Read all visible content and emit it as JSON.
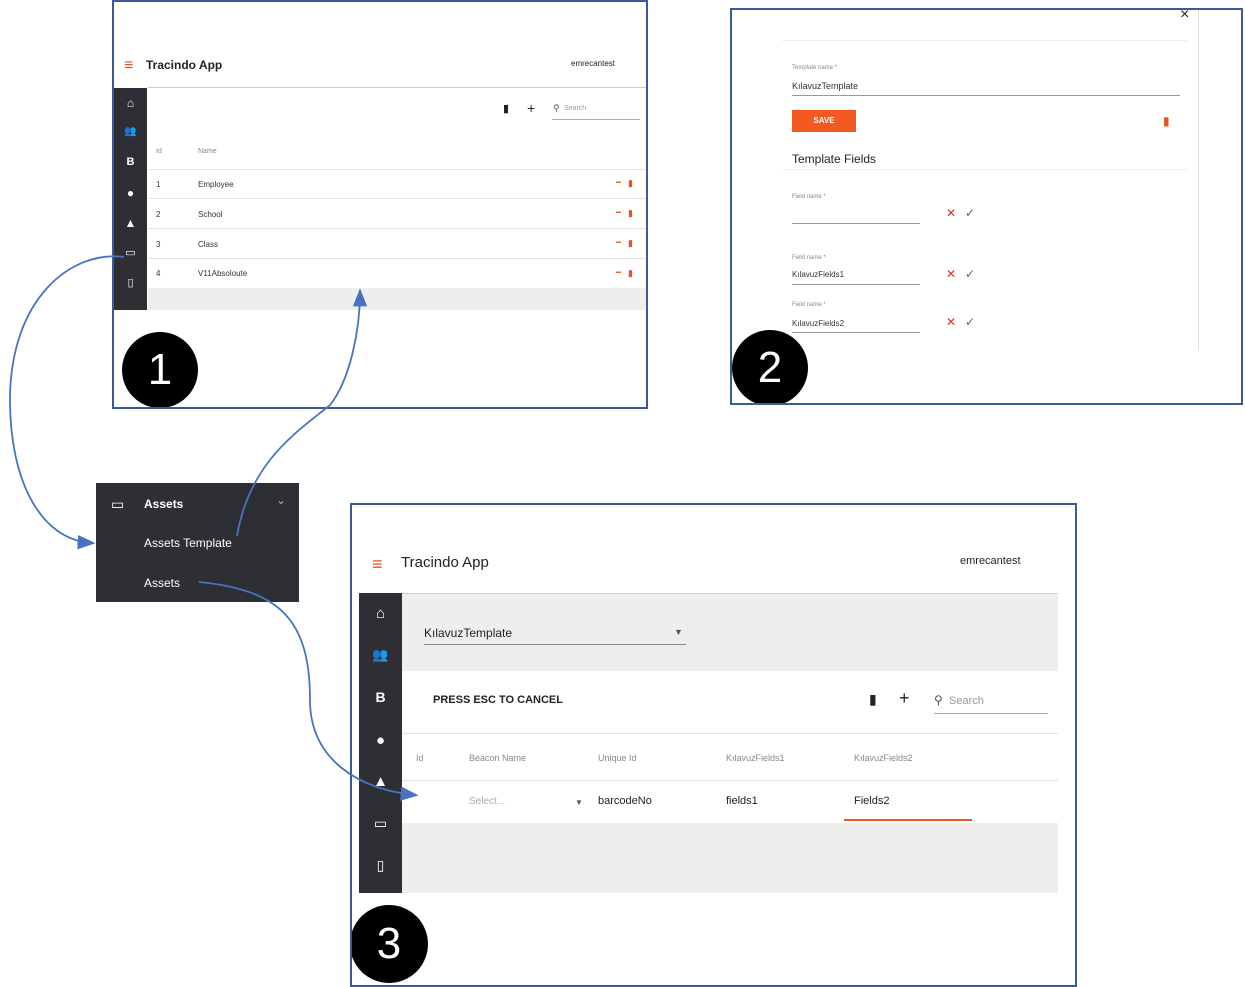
{
  "panel1": {
    "app_title": "Tracindo App",
    "user": "emrecantest",
    "search_placeholder": "Search",
    "columns": {
      "id": "Id",
      "name": "Name"
    },
    "rows": [
      {
        "id": "1",
        "name": "Employee"
      },
      {
        "id": "2",
        "name": "School"
      },
      {
        "id": "3",
        "name": "Class"
      },
      {
        "id": "4",
        "name": "V11Absoloute"
      }
    ],
    "badge": "1"
  },
  "panel2": {
    "close": "×",
    "template_name_label": "Template name *",
    "template_name_value": "KılavuzTemplate",
    "save_label": "SAVE",
    "section_title": "Template Fields",
    "fields": [
      {
        "label": "Field name *",
        "value": ""
      },
      {
        "label": "Field name *",
        "value": "KılavuzFields1"
      },
      {
        "label": "Field name *",
        "value": "KılavuzFields2"
      }
    ],
    "badge": "2"
  },
  "menu": {
    "title": "Assets",
    "items": [
      "Assets Template",
      "Assets"
    ]
  },
  "panel3": {
    "app_title": "Tracindo App",
    "user": "emrecantest",
    "template_select": "KılavuzTemplate",
    "cancel_hint": "PRESS ESC TO CANCEL",
    "search_placeholder": "Search",
    "columns": [
      "Id",
      "Beacon Name",
      "Unique Id",
      "KılavuzFields1",
      "KılavuzFields2"
    ],
    "edit_row": {
      "beacon_placeholder": "Select...",
      "unique_id": "barcodeNo",
      "field1": "fields1",
      "field2": "Fields2"
    },
    "badge": "3"
  },
  "rail_icons": [
    "home-icon",
    "people-icon",
    "b-icon",
    "globe-icon",
    "warning-icon",
    "folder-icon",
    "map-icon"
  ],
  "colors": {
    "accent": "#e8541e",
    "rail": "#2e2f35",
    "frame": "#3a5a9a",
    "arrow": "#4a72c4"
  }
}
